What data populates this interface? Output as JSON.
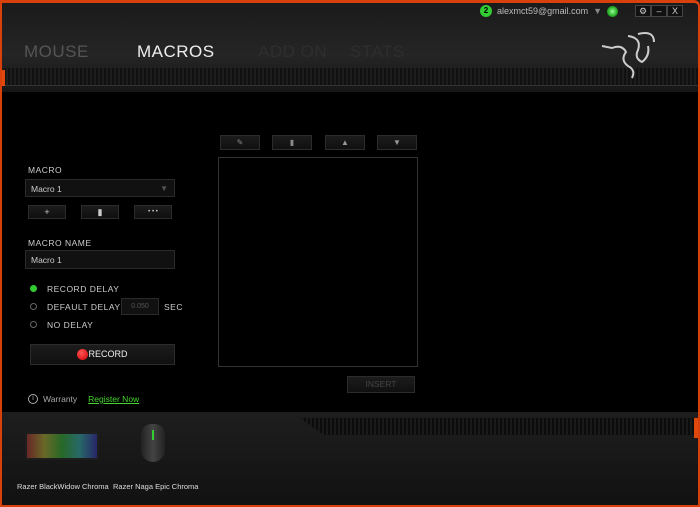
{
  "header": {
    "tabs": [
      {
        "label": "MOUSE",
        "active": false
      },
      {
        "label": "MACROS",
        "active": true
      },
      {
        "label": "ADD ON",
        "active": false
      },
      {
        "label": "STATS",
        "active": false
      }
    ],
    "notification_count": "2",
    "user_email": "alexmct59@gmail.com",
    "window_buttons": {
      "settings": "⚙",
      "minimize": "–",
      "close": "X"
    }
  },
  "macro_panel": {
    "macro_label": "MACRO",
    "selected_macro": "Macro 1",
    "add_label": "+",
    "delete_icon": "trash-icon",
    "more_label": "• • •",
    "macro_name_label": "MACRO NAME",
    "macro_name_value": "Macro 1",
    "delay_options": [
      {
        "label": "RECORD DELAY",
        "selected": true
      },
      {
        "label": "DEFAULT DELAY",
        "selected": false
      },
      {
        "label": "NO DELAY",
        "selected": false
      }
    ],
    "default_delay_value": "0.050",
    "delay_unit": "SEC",
    "record_label": "RECORD"
  },
  "editor": {
    "toolbar": [
      "pencil-icon",
      "trash-icon",
      "arrow-up-icon",
      "arrow-down-icon"
    ],
    "insert_label": "INSERT"
  },
  "warranty": {
    "label": "Warranty",
    "link": "Register Now"
  },
  "devices": [
    {
      "name": "Razer BlackWidow Chroma"
    },
    {
      "name": "Razer Naga Epic Chroma"
    }
  ],
  "colors": {
    "accent": "#d8400c",
    "green": "#44d62c"
  }
}
